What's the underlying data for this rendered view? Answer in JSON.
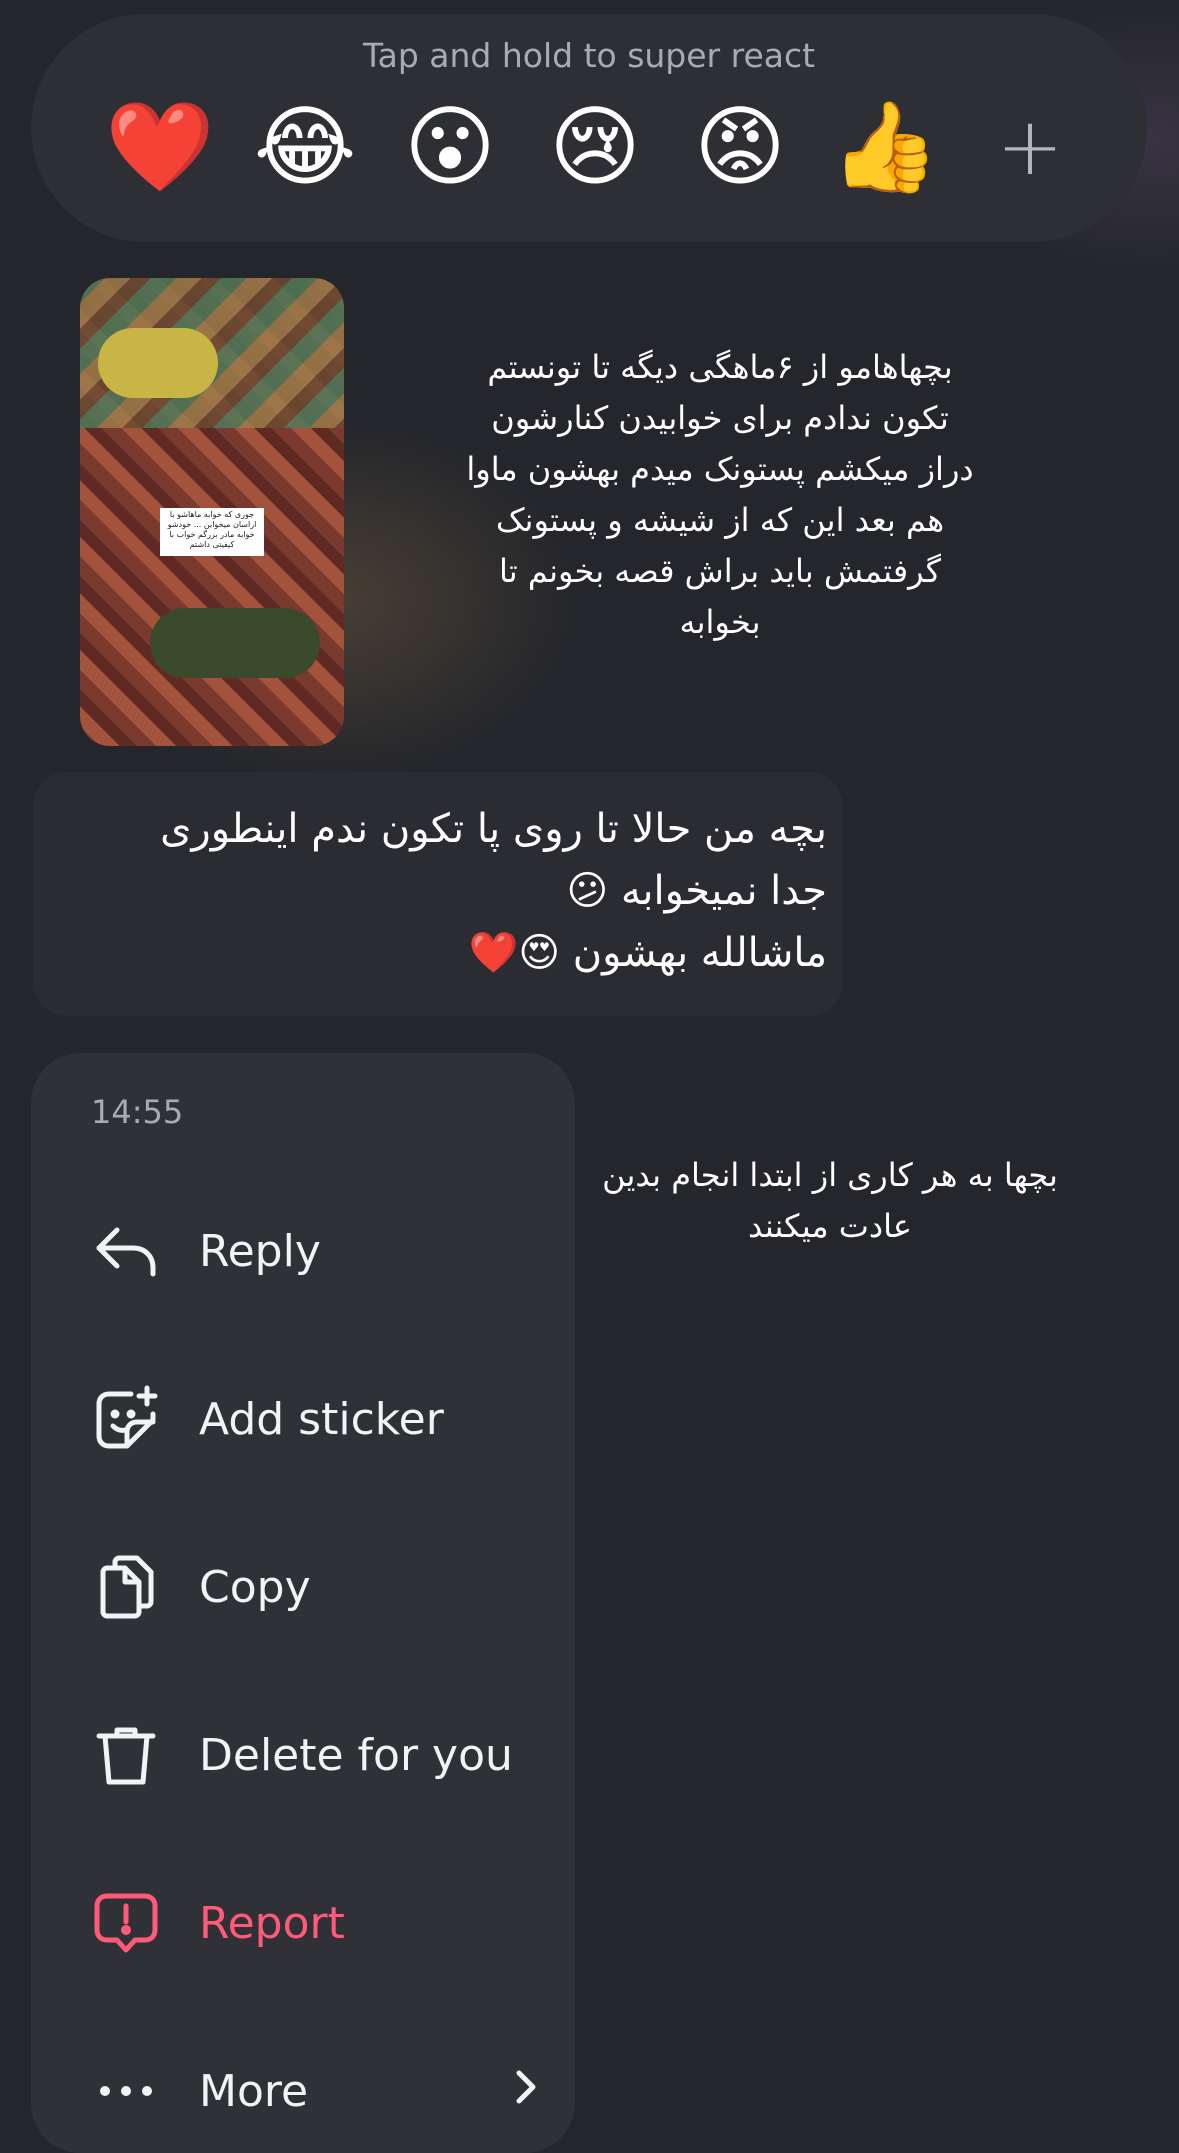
{
  "reactions": {
    "hint": "Tap and hold to super react",
    "emojis": [
      {
        "name": "red-heart-emoji",
        "glyph": "❤️"
      },
      {
        "name": "tears-of-joy-emoji",
        "glyph": "😂"
      },
      {
        "name": "surprised-emoji",
        "glyph": "😮"
      },
      {
        "name": "crying-emoji",
        "glyph": "😢"
      },
      {
        "name": "angry-emoji",
        "glyph": "😡"
      },
      {
        "name": "thumbs-up-emoji",
        "glyph": "👍"
      }
    ],
    "add_icon": "plus-icon",
    "add_glyph": "+"
  },
  "shared_post": {
    "thumbnail_caption": "جوری که خوابه ماهاشو با اراسان میخوابن ... خودشو خوابه مادر بزرگم خواب با کیفیتی داشتم",
    "caption": "بچهاهامو از ۶ماهگی دیگه تا تونستم تکون ندادم برای خوابیدن کنارشون دراز میکشم پستونک میدم بهشون ماوا هم بعد این که از شیشه و پستونک گرفتمش باید براش قصه بخونم تا بخوابه"
  },
  "message": {
    "line1": "بچه من حالا تا روی پا تکون ندم اینطوری",
    "line2": "جدا نمیخوابه 😕",
    "line3": "ماشالله بهشون 😍❤️"
  },
  "second_post": {
    "caption": "بچها به هر کاری از ابتدا انجام بدین عادت میکنند"
  },
  "menu": {
    "time": "14:55",
    "items": [
      {
        "label": "Reply",
        "icon": "reply-icon"
      },
      {
        "label": "Add sticker",
        "icon": "add-sticker-icon"
      },
      {
        "label": "Copy",
        "icon": "copy-icon"
      },
      {
        "label": "Delete for you",
        "icon": "trash-icon"
      },
      {
        "label": "Report",
        "icon": "report-icon"
      },
      {
        "label": "More",
        "icon": "more-icon"
      }
    ]
  },
  "colors": {
    "background": "#24262b",
    "menu_background": "#2f3136",
    "danger": "#ff5a78",
    "muted_text": "#a9abb0"
  }
}
